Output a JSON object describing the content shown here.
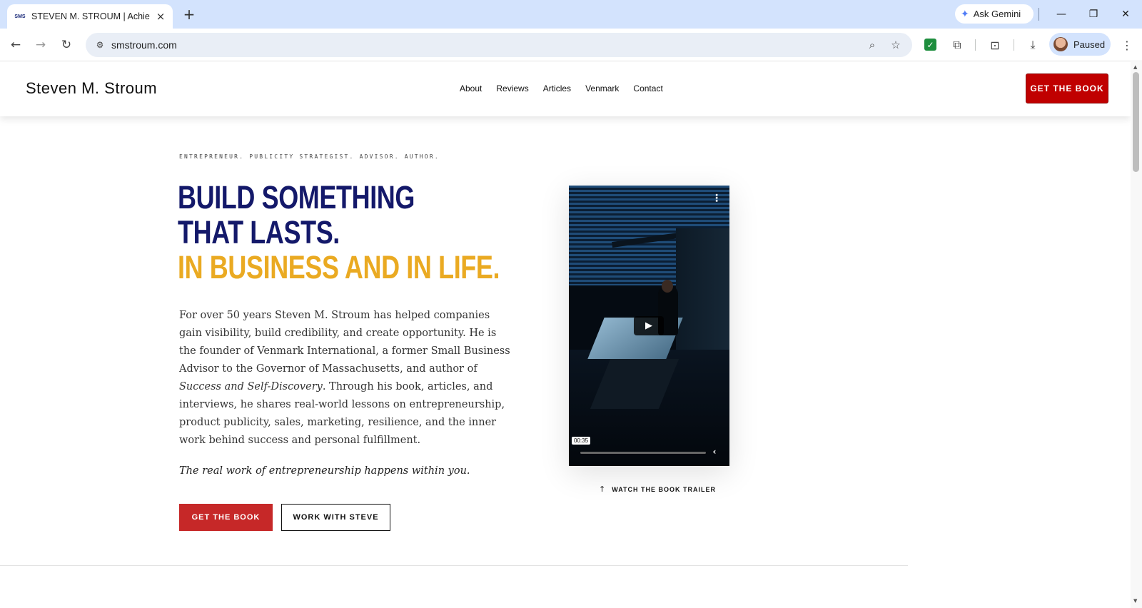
{
  "browser": {
    "tab": {
      "favicon": "SMS",
      "title": "STEVEN M. STROUM | Achieve S",
      "close_icon": "×"
    },
    "new_tab_icon": "+",
    "ask_gemini": "Ask Gemini",
    "window": {
      "minimize": "—",
      "restore": "❐",
      "close": "✕"
    },
    "nav": {
      "back": "←",
      "forward": "→",
      "reload": "↻"
    },
    "url": "smstroum.com",
    "toolbar_icons": {
      "site_info": "⚙",
      "zoom": "⌕",
      "bookmark": "☆",
      "extension_check": "✓",
      "extensions": "⧉",
      "tab_search": "⊡",
      "download": "⤓",
      "menu": "⋮"
    },
    "profile_label": "Paused"
  },
  "site": {
    "logo": "Steven M. Stroum",
    "nav": [
      "About",
      "Reviews",
      "Articles",
      "Venmark",
      "Contact"
    ],
    "header_cta": "GET THE BOOK"
  },
  "hero": {
    "eyebrow": "ENTREPRENEUR. PUBLICITY STRATEGIST. ADVISOR. AUTHOR.",
    "headline_line1": "BUILD SOMETHING",
    "headline_line2": "THAT LASTS.",
    "headline_line3": "IN BUSINESS AND IN LIFE.",
    "body_part1": "For over 50 years Steven M. Stroum has helped companies gain visibility, build credibility, and create opportunity. He is the founder of Venmark International, a former Small Business Advisor to the Governor of Massachusetts, and author of ",
    "body_book": "Success and Self-Discovery",
    "body_part2": ". Through his book, articles, and interviews, he shares real-world lessons on entrepreneurship, product publicity, sales, marketing, resilience, and the inner work behind success and personal fulfillment.",
    "tagline": "The real work of entrepreneurship happens within you.",
    "primary_button": "GET THE BOOK",
    "secondary_button": "WORK WITH STEVE"
  },
  "video": {
    "menu_icon": "⋮",
    "play_icon": "▶",
    "time": "00:35",
    "back_icon": "‹",
    "progress": 0,
    "trailer_arrow": "↑",
    "trailer_label": "WATCH THE BOOK TRAILER"
  },
  "scrollbar": {
    "up": "▲",
    "down": "▼"
  },
  "colors": {
    "navy": "#14196a",
    "gold": "#eaaa22",
    "cta_red": "#c00000"
  }
}
